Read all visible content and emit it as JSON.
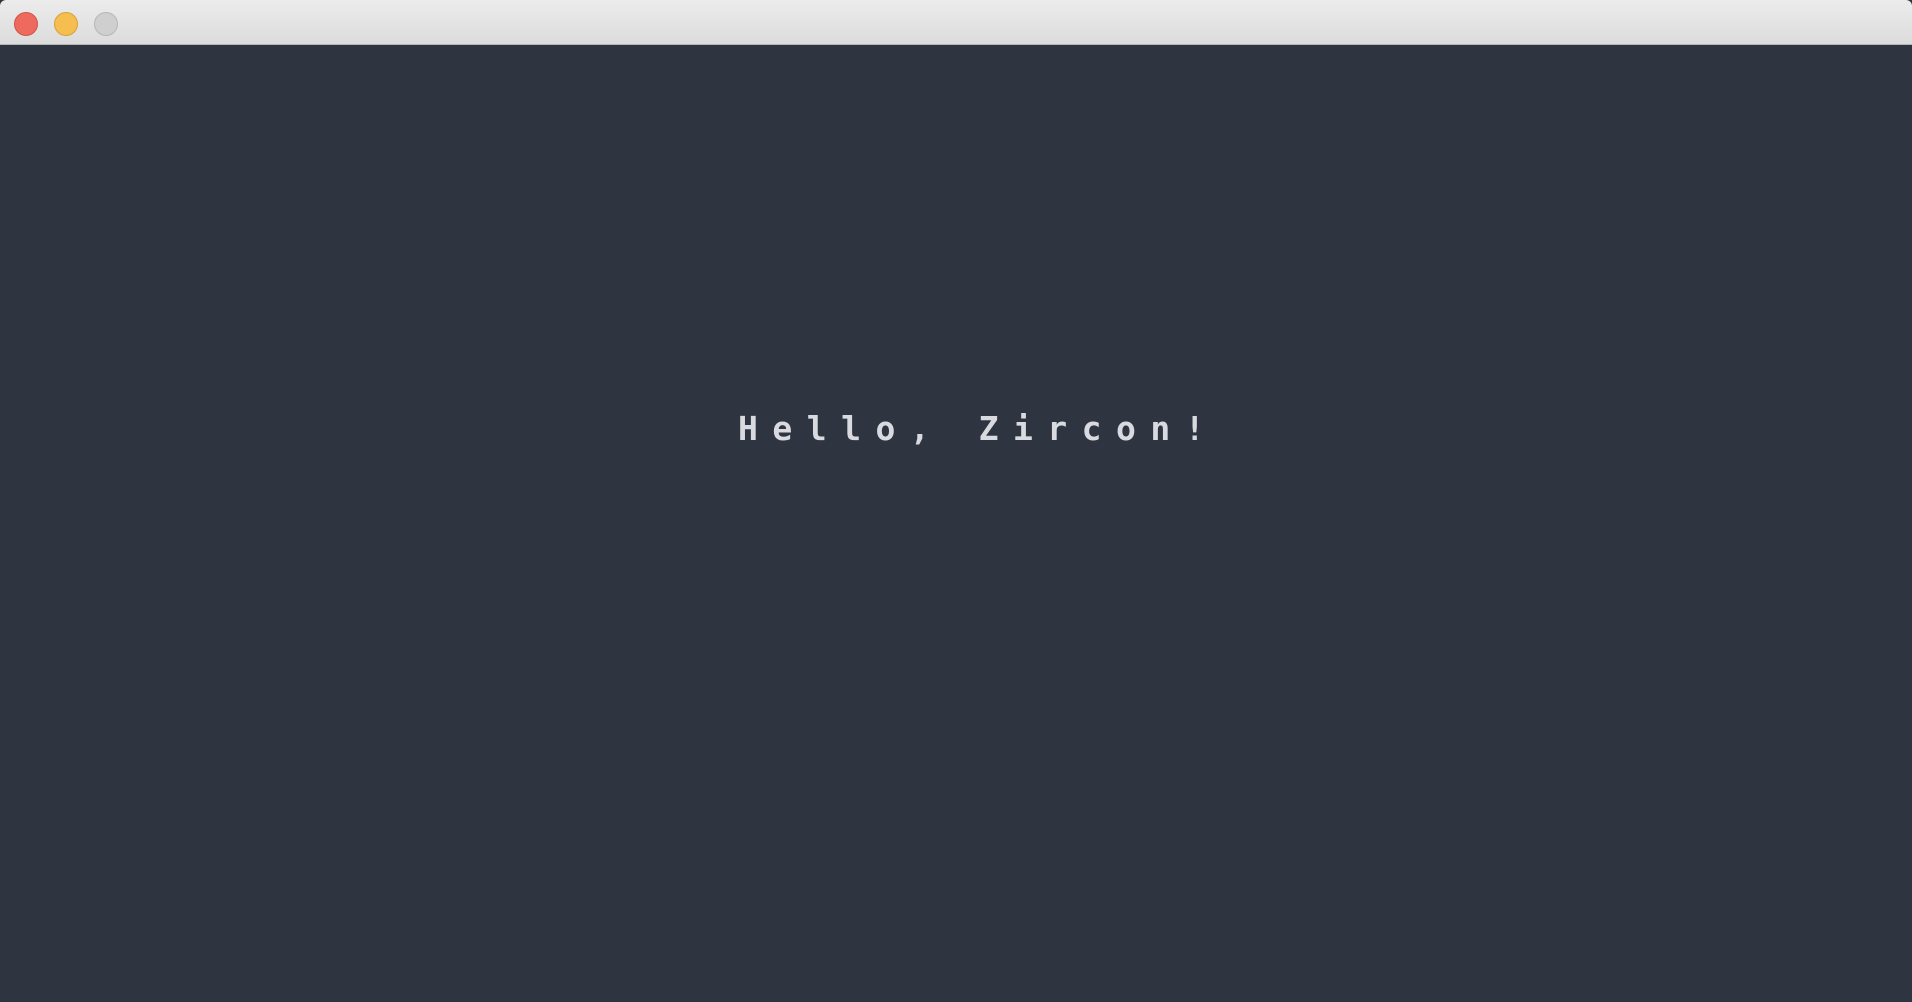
{
  "window": {
    "background_color": "#2f3441",
    "controls": {
      "close": {
        "icon": "close-traffic-light-icon",
        "color": "#ee6a5f"
      },
      "minimize": {
        "icon": "minimize-traffic-light-icon",
        "color": "#f5be4f"
      },
      "zoom": {
        "icon": "zoom-traffic-light-icon",
        "color": "#cfcfcf"
      }
    }
  },
  "content": {
    "message": "Hello, Zircon!",
    "text_color": "#d8dadf"
  }
}
